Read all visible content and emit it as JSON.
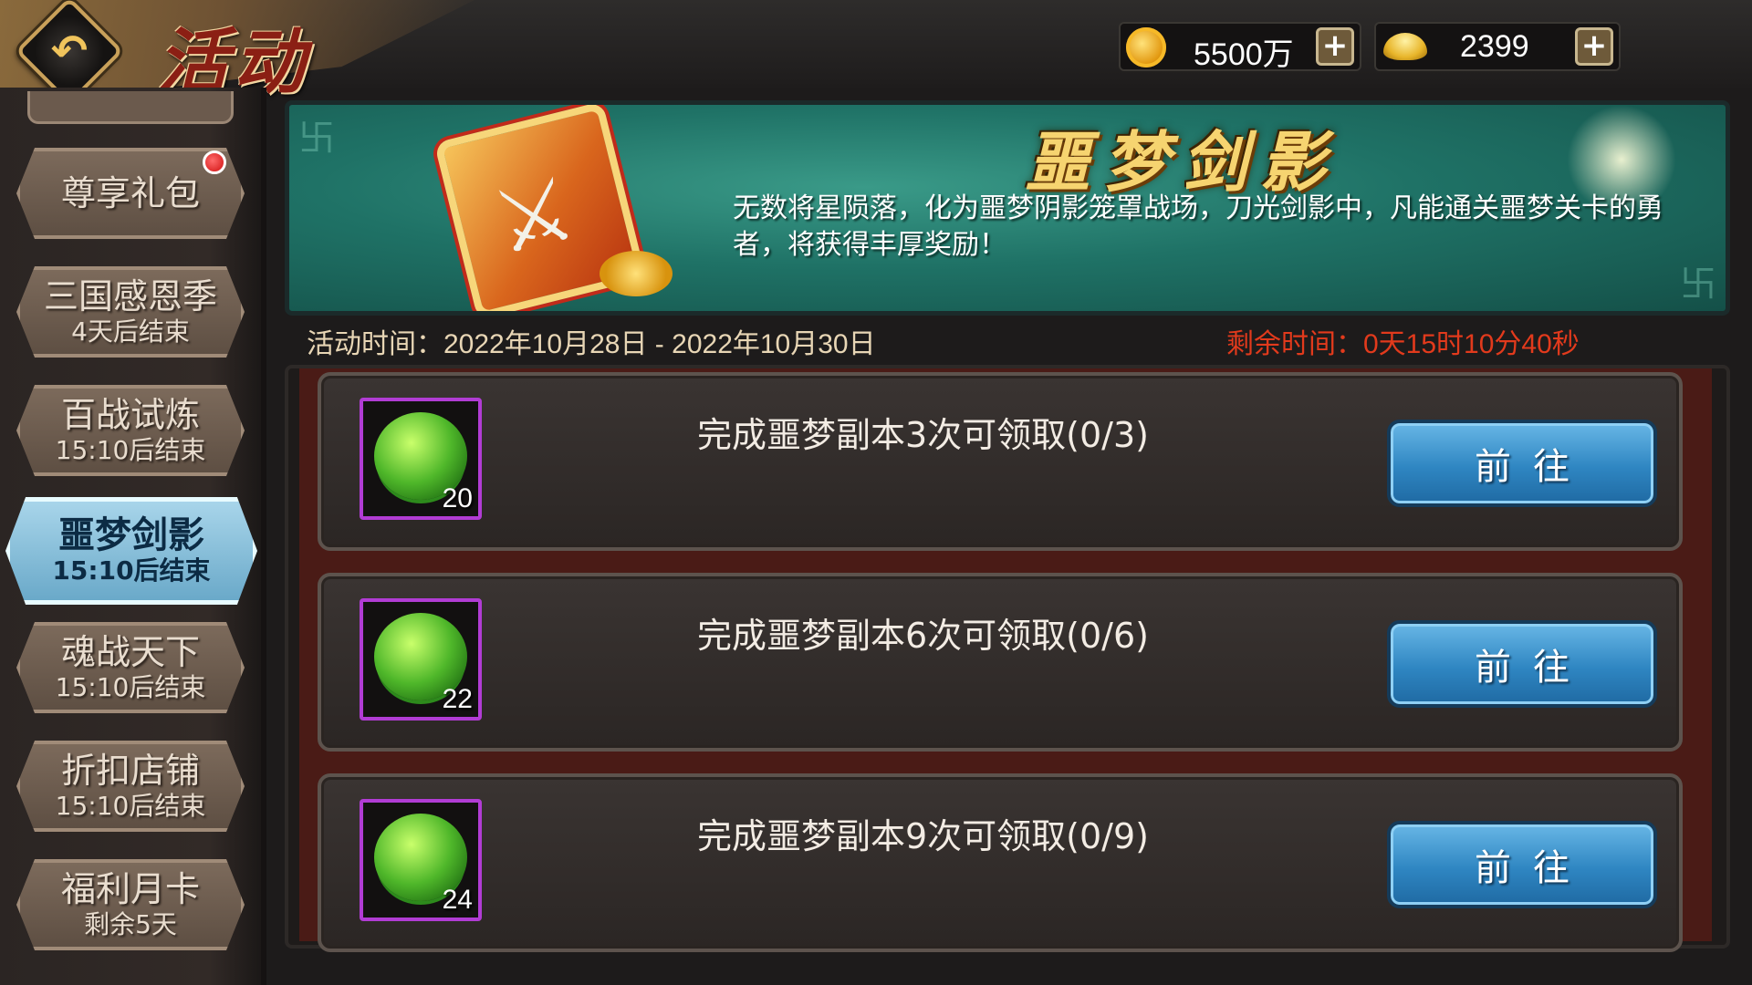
{
  "header": {
    "title": "活动",
    "gold": "5500万",
    "ingot": "2399"
  },
  "sidebar": {
    "items": [
      {
        "label": "尊享礼包",
        "sub": ""
      },
      {
        "label": "三国感恩季",
        "sub": "4天后结束"
      },
      {
        "label": "百战试炼",
        "sub": "15:10后结束"
      },
      {
        "label": "噩梦剑影",
        "sub": "15:10后结束"
      },
      {
        "label": "魂战天下",
        "sub": "15:10后结束"
      },
      {
        "label": "折扣店铺",
        "sub": "15:10后结束"
      },
      {
        "label": "福利月卡",
        "sub": "剩余5天"
      }
    ]
  },
  "banner": {
    "title": "噩梦剑影",
    "description": "无数将星陨落，化为噩梦阴影笼罩战场，刀光剑影中，凡能通关噩梦关卡的勇者，将获得丰厚奖励！"
  },
  "time": {
    "activity": "活动时间：2022年10月28日 - 2022年10月30日",
    "remaining": "剩余时间：0天15时10分40秒"
  },
  "tasks": [
    {
      "desc": "完成噩梦副本3次可领取(0/3)",
      "count": "20",
      "button": "前往"
    },
    {
      "desc": "完成噩梦副本6次可领取(0/6)",
      "count": "22",
      "button": "前往"
    },
    {
      "desc": "完成噩梦副本9次可领取(0/9)",
      "count": "24",
      "button": "前往"
    }
  ],
  "colors": {
    "accent_active": "#8fcbe6",
    "remaining_time": "#e23a1c",
    "item_border": "#b13cd4"
  }
}
